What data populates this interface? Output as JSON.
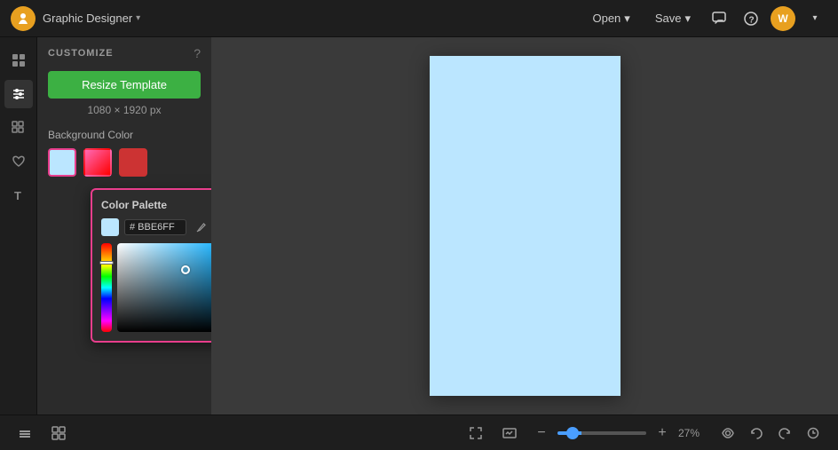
{
  "app": {
    "title": "Graphic Designer",
    "chevron": "▾"
  },
  "nav": {
    "open_label": "Open",
    "save_label": "Save",
    "open_chevron": "▾",
    "save_chevron": "▾"
  },
  "user": {
    "avatar_initials": "W"
  },
  "panel": {
    "customize_title": "CUSTOMIZE",
    "resize_btn_label": "Resize Template",
    "dimensions": "1080 × 1920 px",
    "background_color_label": "Background Color"
  },
  "color_palette": {
    "title": "Color Palette",
    "hex_value": "# BBE6FF"
  },
  "zoom": {
    "value": 27,
    "label": "27%",
    "minus": "−",
    "plus": "+"
  },
  "bottom_bar": {
    "layers_icon": "layers",
    "grid_icon": "grid",
    "expand_icon": "expand",
    "image_icon": "image"
  }
}
